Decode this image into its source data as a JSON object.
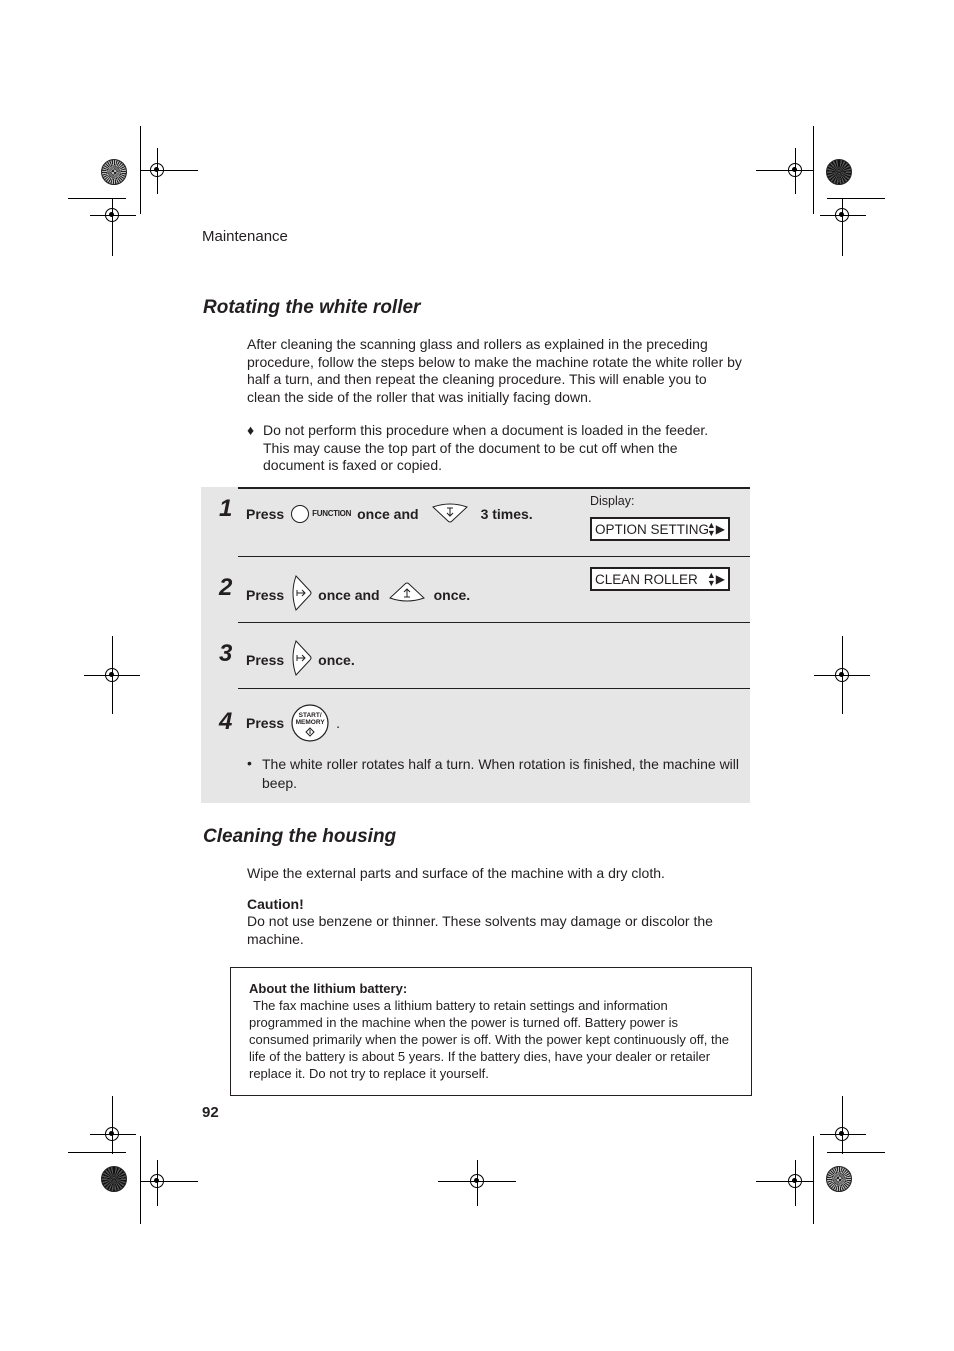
{
  "header": {
    "section": "Maintenance"
  },
  "rotating": {
    "title": "Rotating the white roller",
    "intro": "After cleaning the scanning glass and rollers as explained in the preceding procedure, follow the steps below to make the machine rotate the white roller by half a turn, and then repeat the cleaning procedure. This will enable you to clean the side of the roller that was initially facing down.",
    "bullet_glyph": "♦",
    "note": "Do not perform this procedure when a document is loaded in the feeder. This may cause the top part of the document to be cut off when the document is faxed or copied."
  },
  "steps": {
    "display_label": "Display:",
    "items": [
      {
        "number": "1",
        "parts": [
          "Press",
          "once and",
          "3 times."
        ],
        "key1_label": "FUNCTION",
        "display": "OPTION SETTING"
      },
      {
        "number": "2",
        "parts": [
          "Press",
          "once and",
          "once."
        ],
        "display": "CLEAN ROLLER"
      },
      {
        "number": "3",
        "parts": [
          "Press",
          "once."
        ]
      },
      {
        "number": "4",
        "parts": [
          "Press",
          "."
        ],
        "key_label_top": "START/",
        "key_label_bottom": "MEMORY",
        "bullet_glyph": "•",
        "note": "The white roller rotates half a turn. When rotation is finished, the machine will beep."
      }
    ]
  },
  "cleaning": {
    "title": "Cleaning the housing",
    "text": "Wipe the external parts and surface of the machine with a dry cloth.",
    "caution_title": "Caution!",
    "caution_text": "Do not use benzene or thinner. These solvents may damage or discolor the machine."
  },
  "battery": {
    "title": "About the lithium battery:",
    "text": "The fax machine uses a lithium battery to retain settings and information programmed in the machine when the power is turned off. Battery power is consumed primarily when the power is off. With the power kept continuously off, the life of the battery is about 5 years. If the battery dies, have your dealer or retailer replace it. Do not try to replace it yourself."
  },
  "footer": {
    "page_number": "92"
  }
}
